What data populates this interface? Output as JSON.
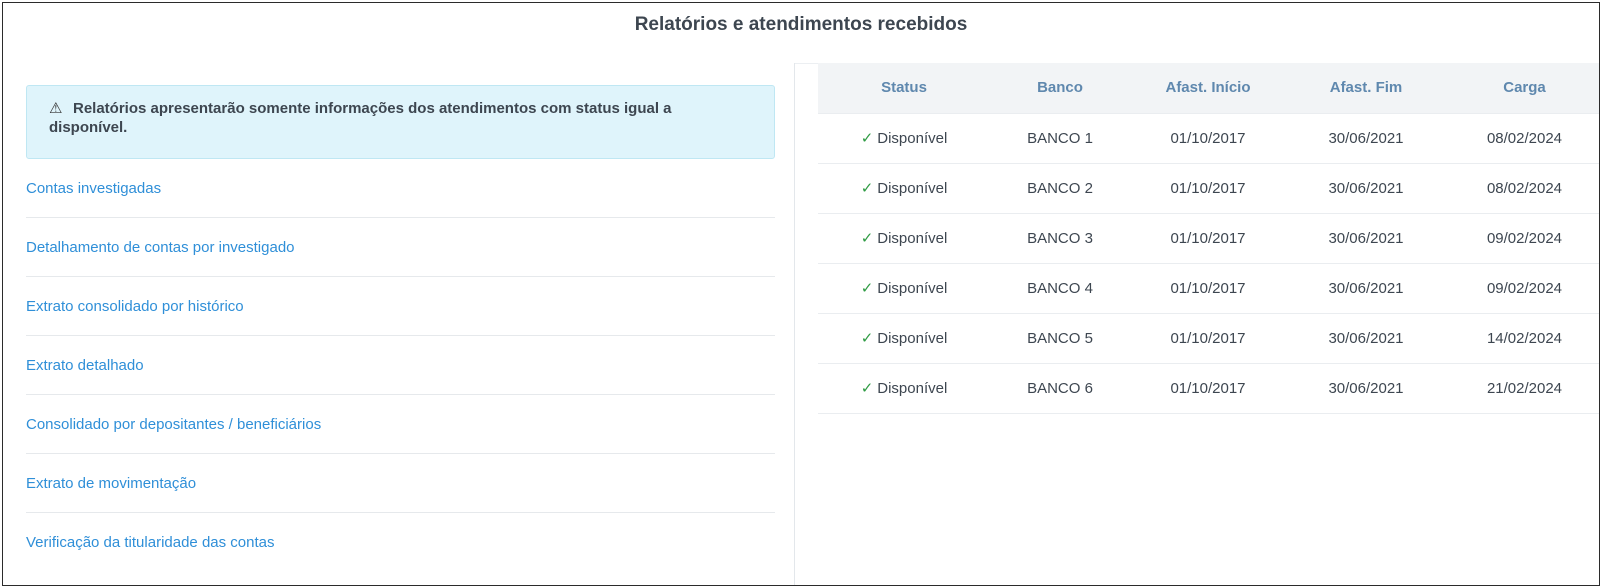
{
  "page": {
    "title": "Relatórios e atendimentos recebidos"
  },
  "alert": {
    "icon": "warning-triangle-icon",
    "text": "Relatórios apresentarão somente informações dos atendimentos com status igual a disponível."
  },
  "reports": [
    {
      "label": "Contas investigadas"
    },
    {
      "label": "Detalhamento de contas por investigado"
    },
    {
      "label": "Extrato consolidado por histórico"
    },
    {
      "label": "Extrato detalhado"
    },
    {
      "label": "Consolidado por depositantes / beneficiários"
    },
    {
      "label": "Extrato de movimentação"
    },
    {
      "label": "Verificação da titularidade das contas"
    }
  ],
  "table": {
    "headers": [
      "Status",
      "Banco",
      "Afast. Início",
      "Afast. Fim",
      "Carga"
    ],
    "status_color": "#2e9b43",
    "rows": [
      {
        "status": "Disponível",
        "banco": "BANCO 1",
        "inicio": "01/10/2017",
        "fim": "30/06/2021",
        "carga": "08/02/2024"
      },
      {
        "status": "Disponível",
        "banco": "BANCO 2",
        "inicio": "01/10/2017",
        "fim": "30/06/2021",
        "carga": "08/02/2024"
      },
      {
        "status": "Disponível",
        "banco": "BANCO 3",
        "inicio": "01/10/2017",
        "fim": "30/06/2021",
        "carga": "09/02/2024"
      },
      {
        "status": "Disponível",
        "banco": "BANCO 4",
        "inicio": "01/10/2017",
        "fim": "30/06/2021",
        "carga": "09/02/2024"
      },
      {
        "status": "Disponível",
        "banco": "BANCO 5",
        "inicio": "01/10/2017",
        "fim": "30/06/2021",
        "carga": "14/02/2024"
      },
      {
        "status": "Disponível",
        "banco": "BANCO 6",
        "inicio": "01/10/2017",
        "fim": "30/06/2021",
        "carga": "21/02/2024"
      }
    ]
  }
}
